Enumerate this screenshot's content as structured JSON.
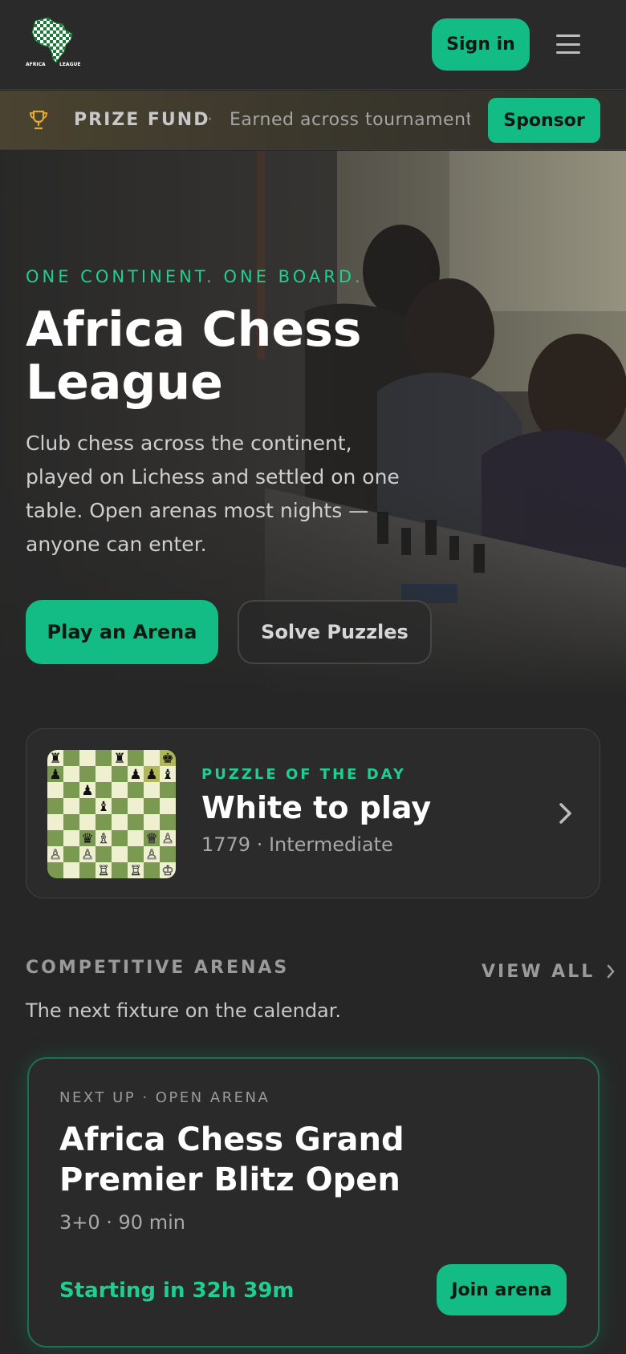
{
  "header": {
    "logo_alt": "Africa Chess League",
    "logo_text_left": "AFRICA",
    "logo_text_right": "LEAGUE",
    "signin_label": "Sign in"
  },
  "prize_bar": {
    "label": "PRIZE FUND",
    "separator": "·",
    "text": "Earned across tournaments",
    "sponsor_label": "Sponsor"
  },
  "hero": {
    "tagline": "ONE CONTINENT. ONE BOARD.",
    "title": "Africa Chess League",
    "description": "Club chess across the continent, played on Lichess and settled on one table. Open arenas most nights — anyone can enter.",
    "primary_cta": "Play an Arena",
    "secondary_cta": "Solve Puzzles"
  },
  "puzzle": {
    "kicker": "PUZZLE OF THE DAY",
    "title": "White to play",
    "meta": "1779 · Intermediate"
  },
  "arenas": {
    "section_title": "COMPETITIVE ARENAS",
    "view_all": "VIEW ALL",
    "subtitle": "The next fixture on the calendar.",
    "next": {
      "kicker": "NEXT UP · OPEN ARENA",
      "title": "Africa Chess Grand Premier Blitz Open",
      "meta": "3+0 · 90 min",
      "countdown": "Starting in 32h 39m",
      "join_label": "Join arena"
    }
  },
  "colors": {
    "accent": "#13bb85",
    "accent_text": "#1fcf92",
    "background": "#262626",
    "card": "#2b2b2b"
  },
  "icons": [
    "africa-logo-icon",
    "hamburger-menu-icon",
    "trophy-icon",
    "chevron-right-icon"
  ]
}
